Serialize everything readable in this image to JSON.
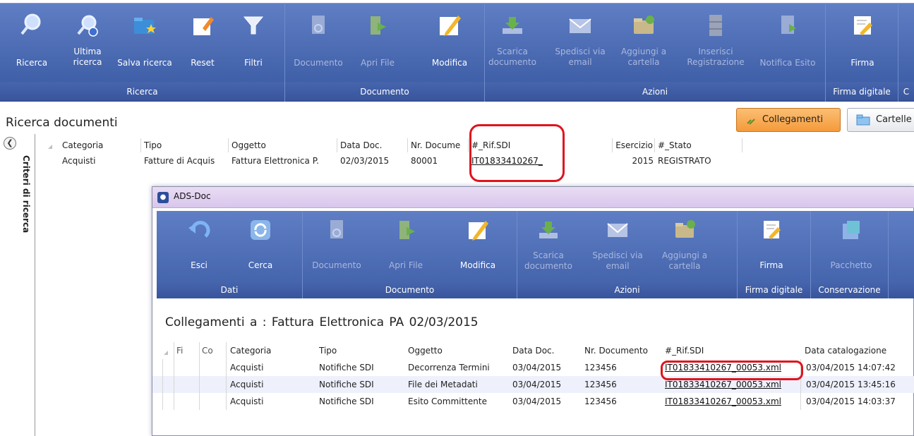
{
  "ribbon": {
    "buttons": [
      {
        "id": "ricerca",
        "label": "Ricerca",
        "icon": "magnifier-icon",
        "enabled": true
      },
      {
        "id": "ultima",
        "label": "Ultima ricerca",
        "icon": "search-history-icon",
        "enabled": true
      },
      {
        "id": "salva",
        "label": "Salva ricerca",
        "icon": "save-search-folder-icon",
        "enabled": true
      },
      {
        "id": "reset",
        "label": "Reset",
        "icon": "eraser-icon",
        "enabled": true
      },
      {
        "id": "filtri",
        "label": "Filtri",
        "icon": "filter-funnel-icon",
        "enabled": true
      },
      {
        "id": "documento",
        "label": "Documento",
        "icon": "document-preview-icon",
        "enabled": false
      },
      {
        "id": "aprifile",
        "label": "Apri File",
        "icon": "open-file-icon",
        "enabled": false
      },
      {
        "id": "modifica",
        "label": "Modifica",
        "icon": "pencil-icon",
        "enabled": true
      },
      {
        "id": "scarica",
        "label": "Scarica documento",
        "icon": "download-icon",
        "enabled": false
      },
      {
        "id": "spedisci",
        "label": "Spedisci via email",
        "icon": "email-icon",
        "enabled": false
      },
      {
        "id": "aggiungi",
        "label": "Aggiungi a cartella",
        "icon": "add-folder-icon",
        "enabled": false
      },
      {
        "id": "inserisci",
        "label": "Inserisci Registrazione",
        "icon": "cabinet-icon",
        "enabled": false
      },
      {
        "id": "notifica",
        "label": "Notifica Esito",
        "icon": "notify-document-icon",
        "enabled": false
      },
      {
        "id": "firma",
        "label": "Firma",
        "icon": "sign-pen-icon",
        "enabled": true
      }
    ],
    "groups": {
      "ricerca": "Ricerca",
      "documento": "Documento",
      "azioni": "Azioni",
      "firma_digitale": "Firma digitale",
      "c_cut": "C"
    }
  },
  "search": {
    "title": "Ricerca documenti",
    "side_panel_label": "Criteri di ricerca",
    "collegamenti_button": "Collegamenti",
    "cartelle_button": "Cartelle",
    "columns": [
      "Categoria",
      "Tipo",
      "Oggetto",
      "Data Doc.",
      "Nr. Docume",
      "#_Rif.SDI",
      "Esercizio",
      "#_Stato"
    ],
    "rows": [
      {
        "categoria": "Acquisti",
        "tipo": "Fatture di Acquis",
        "oggetto": "Fattura Elettronica P.",
        "data": "02/03/2015",
        "nr": "80001",
        "rif": "IT01833410267_",
        "esercizio": "2015",
        "stato": "REGISTRATO"
      }
    ]
  },
  "dialog": {
    "title": "ADS-Doc",
    "buttons": [
      {
        "id": "esci",
        "label": "Esci",
        "icon": "undo-arrow-icon",
        "enabled": true
      },
      {
        "id": "cerca",
        "label": "Cerca",
        "icon": "refresh-icon",
        "enabled": true
      },
      {
        "id": "documento",
        "label": "Documento",
        "icon": "document-preview-icon",
        "enabled": false
      },
      {
        "id": "aprifile",
        "label": "Apri File",
        "icon": "open-file-icon",
        "enabled": false
      },
      {
        "id": "modifica",
        "label": "Modifica",
        "icon": "pencil-icon",
        "enabled": true
      },
      {
        "id": "scarica",
        "label": "Scarica documento",
        "icon": "download-icon",
        "enabled": false
      },
      {
        "id": "spedisci",
        "label": "Spedisci via email",
        "icon": "email-icon",
        "enabled": false
      },
      {
        "id": "aggiungi",
        "label": "Aggiungi a cartella",
        "icon": "add-folder-icon",
        "enabled": false
      },
      {
        "id": "firma",
        "label": "Firma",
        "icon": "sign-pen-icon",
        "enabled": true
      },
      {
        "id": "pacchetto",
        "label": "Pacchetto",
        "icon": "package-icon",
        "enabled": false
      }
    ],
    "groups": {
      "dati": "Dati",
      "documento": "Documento",
      "azioni": "Azioni",
      "firma_digitale": "Firma digitale",
      "conservazione": "Conservazione"
    },
    "heading": "Collegamenti a :   Fattura Elettronica PA   02/03/2015",
    "columns": [
      "Fi",
      "Co",
      "Categoria",
      "Tipo",
      "Oggetto",
      "Data Doc.",
      "Nr. Documento",
      "#_Rif.SDI",
      "Data catalogazione"
    ],
    "rows": [
      {
        "categoria": "Acquisti",
        "tipo": "Notifiche SDI",
        "oggetto": "Decorrenza Termini",
        "data": "03/04/2015",
        "nr": "123456",
        "rif": "IT01833410267_00053.xml",
        "catalog": "03/04/2015 14:07:42"
      },
      {
        "categoria": "Acquisti",
        "tipo": "Notifiche SDI",
        "oggetto": "File dei Metadati",
        "data": "03/04/2015",
        "nr": "123456",
        "rif": "IT01833410267_00053.xml",
        "catalog": "03/04/2015 13:45:16"
      },
      {
        "categoria": "Acquisti",
        "tipo": "Notifiche SDI",
        "oggetto": "Esito Committente",
        "data": "03/04/2015",
        "nr": "123456",
        "rif": "IT01833410267_00053.xml",
        "catalog": "03/04/2015 14:03:37"
      }
    ]
  },
  "colors": {
    "ribbon": "#4a68b0",
    "highlight_oval": "#e0141e",
    "collegamenti_button": "#f7a848",
    "dialog_titlebar": "#e0d0f0"
  }
}
